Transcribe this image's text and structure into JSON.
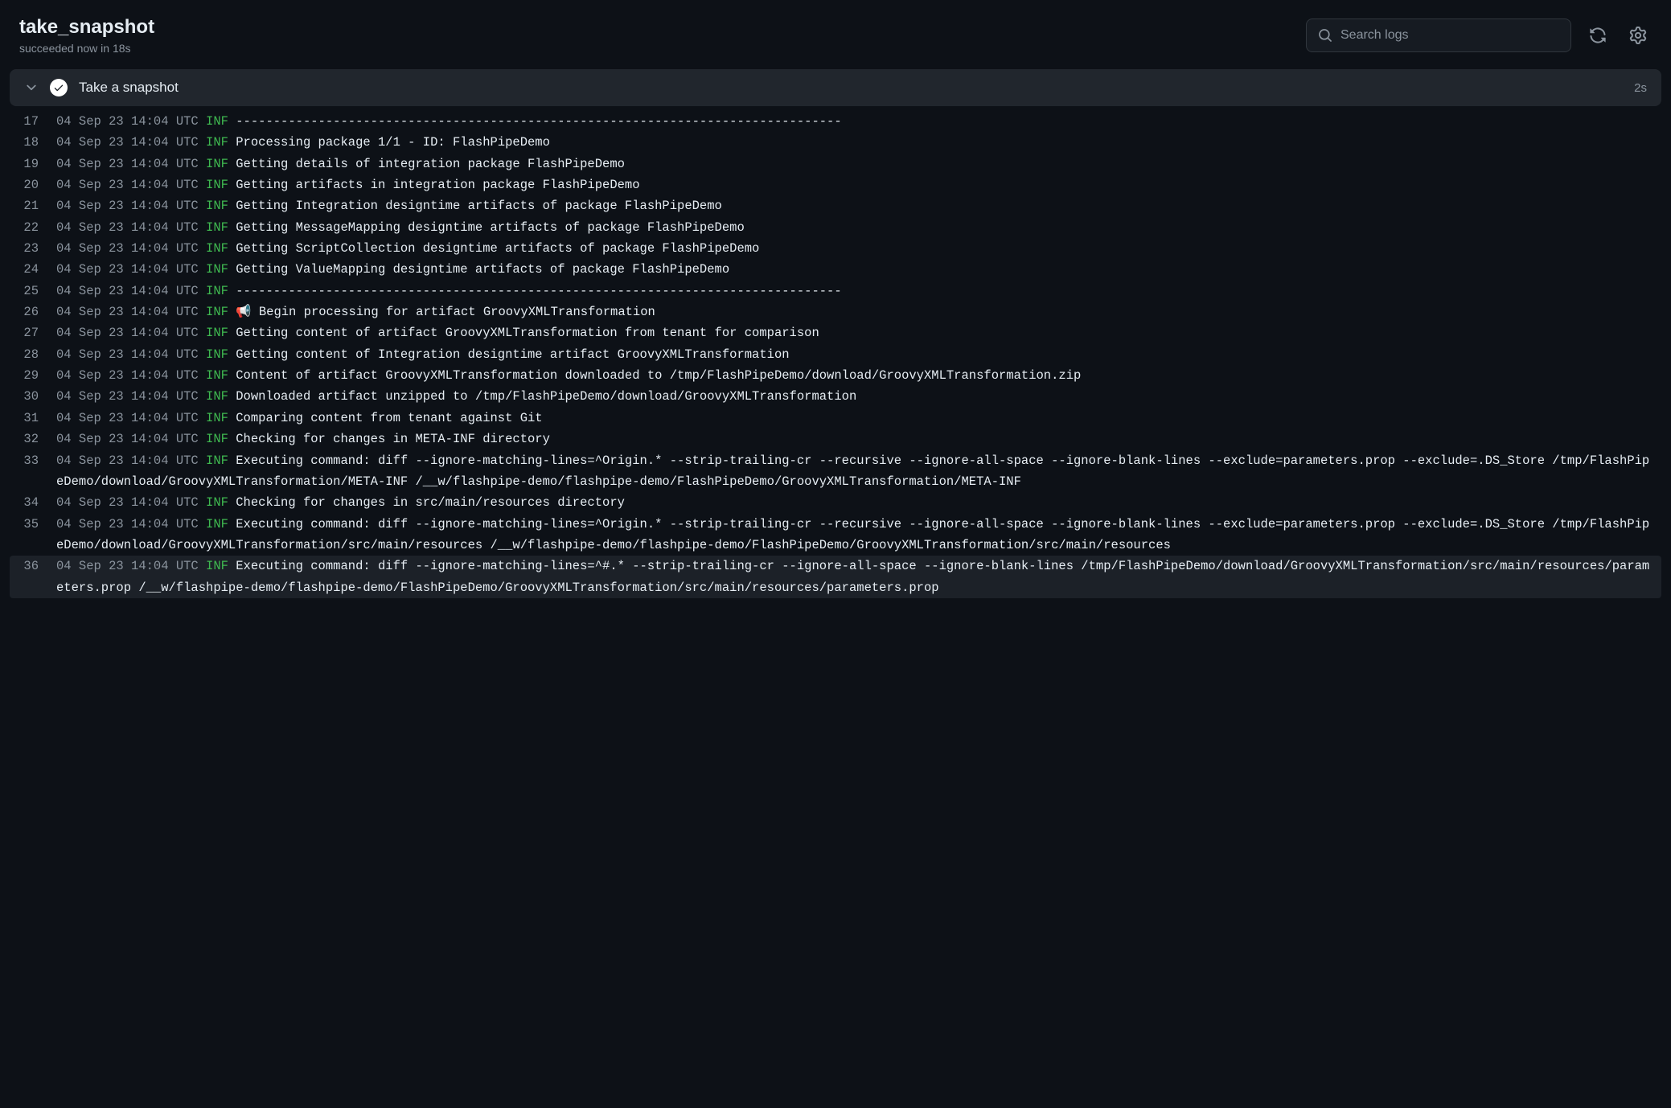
{
  "header": {
    "title": "take_snapshot",
    "subtitle": "succeeded now in 18s",
    "search_placeholder": "Search logs"
  },
  "step": {
    "title": "Take a snapshot",
    "duration": "2s"
  },
  "log_timestamp": "04 Sep 23 14:04 UTC",
  "log_level": "INF",
  "logs": [
    {
      "num": "17",
      "msg": "---------------------------------------------------------------------------------"
    },
    {
      "num": "18",
      "msg": "Processing package 1/1 - ID: FlashPipeDemo"
    },
    {
      "num": "19",
      "msg": "Getting details of integration package FlashPipeDemo"
    },
    {
      "num": "20",
      "msg": "Getting artifacts in integration package FlashPipeDemo"
    },
    {
      "num": "21",
      "msg": "Getting Integration designtime artifacts of package FlashPipeDemo"
    },
    {
      "num": "22",
      "msg": "Getting MessageMapping designtime artifacts of package FlashPipeDemo"
    },
    {
      "num": "23",
      "msg": "Getting ScriptCollection designtime artifacts of package FlashPipeDemo"
    },
    {
      "num": "24",
      "msg": "Getting ValueMapping designtime artifacts of package FlashPipeDemo"
    },
    {
      "num": "25",
      "msg": "---------------------------------------------------------------------------------"
    },
    {
      "num": "26",
      "msg": "📢 Begin processing for artifact GroovyXMLTransformation"
    },
    {
      "num": "27",
      "msg": "Getting content of artifact GroovyXMLTransformation from tenant for comparison"
    },
    {
      "num": "28",
      "msg": "Getting content of Integration designtime artifact GroovyXMLTransformation"
    },
    {
      "num": "29",
      "msg": "Content of artifact GroovyXMLTransformation downloaded to /tmp/FlashPipeDemo/download/GroovyXMLTransformation.zip"
    },
    {
      "num": "30",
      "msg": "Downloaded artifact unzipped to /tmp/FlashPipeDemo/download/GroovyXMLTransformation"
    },
    {
      "num": "31",
      "msg": "Comparing content from tenant against Git"
    },
    {
      "num": "32",
      "msg": "Checking for changes in META-INF directory"
    },
    {
      "num": "33",
      "msg": "Executing command: diff --ignore-matching-lines=^Origin.* --strip-trailing-cr --recursive --ignore-all-space --ignore-blank-lines --exclude=parameters.prop --exclude=.DS_Store /tmp/FlashPipeDemo/download/GroovyXMLTransformation/META-INF /__w/flashpipe-demo/flashpipe-demo/FlashPipeDemo/GroovyXMLTransformation/META-INF"
    },
    {
      "num": "34",
      "msg": "Checking for changes in src/main/resources directory"
    },
    {
      "num": "35",
      "msg": "Executing command: diff --ignore-matching-lines=^Origin.* --strip-trailing-cr --recursive --ignore-all-space --ignore-blank-lines --exclude=parameters.prop --exclude=.DS_Store /tmp/FlashPipeDemo/download/GroovyXMLTransformation/src/main/resources /__w/flashpipe-demo/flashpipe-demo/FlashPipeDemo/GroovyXMLTransformation/src/main/resources"
    },
    {
      "num": "36",
      "msg": "Executing command: diff --ignore-matching-lines=^#.* --strip-trailing-cr --ignore-all-space --ignore-blank-lines /tmp/FlashPipeDemo/download/GroovyXMLTransformation/src/main/resources/parameters.prop /__w/flashpipe-demo/flashpipe-demo/FlashPipeDemo/GroovyXMLTransformation/src/main/resources/parameters.prop"
    }
  ]
}
